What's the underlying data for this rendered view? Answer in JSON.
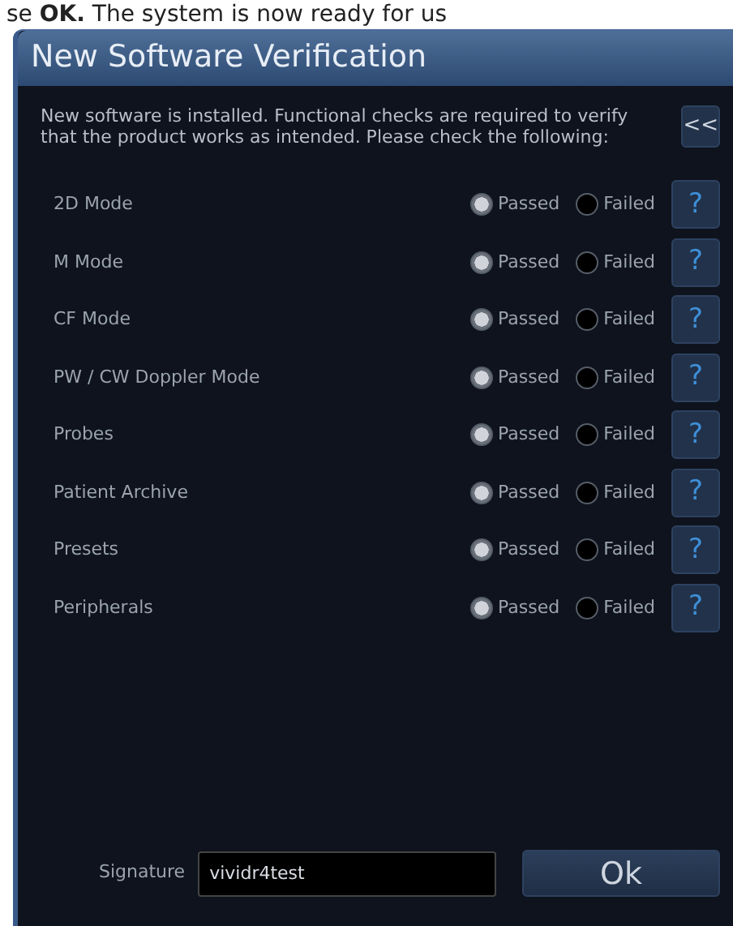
{
  "background_text": "se **OK.** The system is now ready for us",
  "window": {
    "title": "New Software Verification"
  },
  "intro": "New software is installed. Functional checks are required to verify that the product works as intended. Please check the following:",
  "collapse_button": "<<",
  "checks": [
    {
      "label": "2D Mode",
      "options": [
        {
          "label": "Passed",
          "selected": true
        },
        {
          "label": "Failed",
          "selected": false
        }
      ],
      "help": "?"
    },
    {
      "label": "M Mode",
      "options": [
        {
          "label": "Passed",
          "selected": true
        },
        {
          "label": "Failed",
          "selected": false
        }
      ],
      "help": "?"
    },
    {
      "label": "CF Mode",
      "options": [
        {
          "label": "Passed",
          "selected": true
        },
        {
          "label": "Failed",
          "selected": false
        }
      ],
      "help": "?"
    },
    {
      "label": "PW / CW Doppler Mode",
      "options": [
        {
          "label": "Passed",
          "selected": true
        },
        {
          "label": "Failed",
          "selected": false
        }
      ],
      "help": "?"
    },
    {
      "label": "Probes",
      "options": [
        {
          "label": "Passed",
          "selected": true
        },
        {
          "label": "Failed",
          "selected": false
        }
      ],
      "help": "?"
    },
    {
      "label": "Patient Archive",
      "options": [
        {
          "label": "Passed",
          "selected": true
        },
        {
          "label": "Failed",
          "selected": false
        }
      ],
      "help": "?"
    },
    {
      "label": "Presets",
      "options": [
        {
          "label": "Passed",
          "selected": true
        },
        {
          "label": "Failed",
          "selected": false
        }
      ],
      "help": "?"
    },
    {
      "label": "Peripherals",
      "options": [
        {
          "label": "Passed",
          "selected": true
        },
        {
          "label": "Failed",
          "selected": false
        }
      ],
      "help": "?"
    }
  ],
  "signature": {
    "label": "Signature",
    "value": "vividr4test"
  },
  "ok_button": "Ok"
}
